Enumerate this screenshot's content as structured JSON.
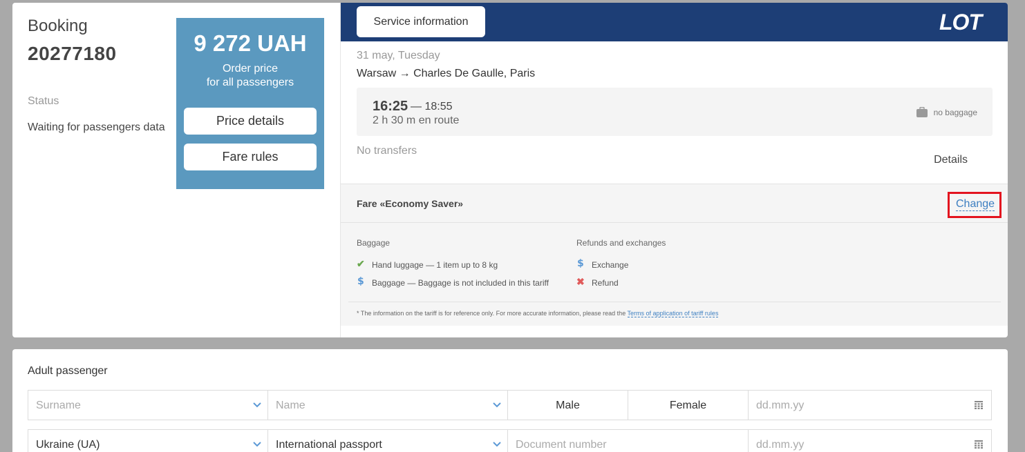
{
  "booking": {
    "label": "Booking",
    "number": "20277180",
    "status_label": "Status",
    "status_value": "Waiting for passengers data"
  },
  "price": {
    "amount": "9 272 UAH",
    "caption_line1": "Order price",
    "caption_line2": "for all passengers",
    "details_button": "Price details",
    "fare_rules_button": "Fare rules"
  },
  "service": {
    "button_label": "Service information",
    "logo_text": "LOT"
  },
  "flight": {
    "date": "31 may, Tuesday",
    "route": "Warsaw → Charles De Gaulle, Paris",
    "departure": "16:25",
    "arrival": "— 18:55",
    "duration": "2 h 30 m en route",
    "baggage": "no baggage",
    "transfers": "No transfers",
    "details_link": "Details"
  },
  "fare": {
    "title": "Fare «Economy Saver»",
    "change_link": "Change",
    "baggage_title": "Baggage",
    "refunds_title": "Refunds and exchanges",
    "baggage_items": [
      {
        "icon": "check-icon",
        "text": "Hand luggage — 1 item up to 8 kg"
      },
      {
        "icon": "dollar-icon",
        "text": "Baggage — Baggage is not included in this tariff"
      }
    ],
    "refund_items": [
      {
        "icon": "dollar-icon",
        "text": "Exchange"
      },
      {
        "icon": "cross-icon",
        "text": "Refund"
      }
    ],
    "note_prefix": "*  The information on the tariff is for reference only. For more accurate information, please read the ",
    "note_link": "Terms of application of tariff rules"
  },
  "passenger": {
    "title": "Adult passenger",
    "surname_placeholder": "Surname",
    "name_placeholder": "Name",
    "male_label": "Male",
    "female_label": "Female",
    "birth_placeholder": "dd.mm.yy",
    "citizenship_value": "Ukraine (UA)",
    "document_type_value": "International passport",
    "document_number_placeholder": "Document number",
    "expiry_placeholder": "dd.mm.yy"
  },
  "colors": {
    "header_navy": "#1d3e76",
    "price_box_blue": "#5b99bf",
    "link_blue": "#3d7fc1",
    "highlight_red": "#e3141f",
    "check_green": "#6aa84f",
    "cross_red": "#e05a5a"
  }
}
